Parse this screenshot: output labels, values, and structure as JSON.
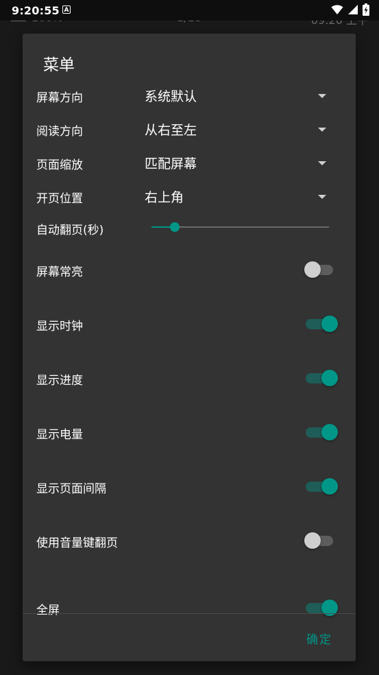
{
  "status_bar": {
    "time": "9:20:55",
    "notification_icon": "A"
  },
  "background": {
    "battery": "100%",
    "page": "1/18",
    "time": "09:20 上午"
  },
  "dialog": {
    "title": "菜单",
    "dropdowns": [
      {
        "label": "屏幕方向",
        "value": "系统默认"
      },
      {
        "label": "阅读方向",
        "value": "从右至左"
      },
      {
        "label": "页面缩放",
        "value": "匹配屏幕"
      },
      {
        "label": "开页位置",
        "value": "右上角"
      }
    ],
    "slider": {
      "label": "自动翻页(秒)",
      "value": 0.13
    },
    "toggles": [
      {
        "label": "屏幕常亮",
        "on": false
      },
      {
        "label": "显示时钟",
        "on": true
      },
      {
        "label": "显示进度",
        "on": true
      },
      {
        "label": "显示电量",
        "on": true
      },
      {
        "label": "显示页面间隔",
        "on": true
      },
      {
        "label": "使用音量键翻页",
        "on": false
      },
      {
        "label": "全屏",
        "on": true
      }
    ],
    "confirm_label": "确定"
  },
  "colors": {
    "accent": "#009688",
    "dialog_bg": "#333333",
    "text": "#ffffff"
  }
}
